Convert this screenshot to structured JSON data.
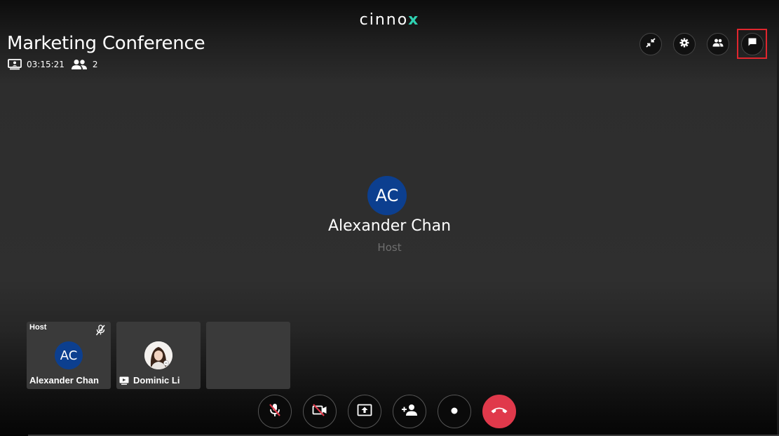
{
  "app": {
    "logo_text": "cinno",
    "logo_accent": "x",
    "accent_color": "#2fd0b1"
  },
  "header": {
    "title": "Marketing Conference",
    "duration": "03:15:21",
    "participant_count": "2"
  },
  "top_buttons": [
    {
      "name": "minimize",
      "icon": "collapse-arrows-icon"
    },
    {
      "name": "settings",
      "icon": "gear-icon"
    },
    {
      "name": "participants",
      "icon": "people-icon"
    },
    {
      "name": "chat",
      "icon": "chat-bubble-icon",
      "highlighted": true
    }
  ],
  "main_speaker": {
    "initials": "AC",
    "name": "Alexander Chan",
    "role": "Host",
    "avatar_color": "#0c3f8f"
  },
  "tiles": [
    {
      "role": "Host",
      "initials": "AC",
      "name": "Alexander Chan",
      "muted": true
    },
    {
      "role": "",
      "name": "Dominic Li",
      "has_photo": true,
      "screen_sharing": true
    },
    {
      "empty": true
    }
  ],
  "controls": [
    {
      "name": "mute-microphone",
      "icon": "microphone-off-icon"
    },
    {
      "name": "toggle-camera",
      "icon": "camera-off-icon"
    },
    {
      "name": "share-screen",
      "icon": "share-screen-icon"
    },
    {
      "name": "add-participant",
      "icon": "add-person-icon"
    },
    {
      "name": "record",
      "icon": "record-dot-icon"
    },
    {
      "name": "end-call",
      "icon": "phone-hangup-icon",
      "color": "#e0394b"
    }
  ]
}
